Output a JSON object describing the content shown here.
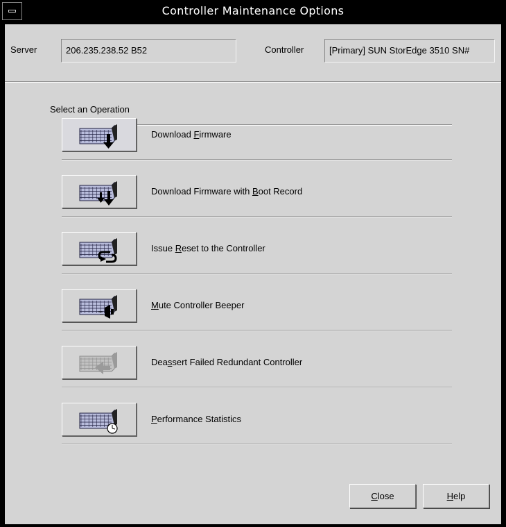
{
  "window": {
    "title": "Controller Maintenance Options"
  },
  "header": {
    "server_label": "Server",
    "server_value": "206.235.238.52 B52",
    "controller_label": "Controller",
    "controller_value": "[Primary] SUN StorEdge 3510 SN#"
  },
  "main": {
    "section_title": "Select an Operation",
    "operations": [
      {
        "pre": "Download ",
        "key": "F",
        "post": "irmware",
        "icon": "download-firmware-icon",
        "enabled": true
      },
      {
        "pre": "Download Firmware with ",
        "key": "B",
        "post": "oot Record",
        "icon": "download-firmware-boot-record-icon",
        "enabled": true
      },
      {
        "pre": "Issue ",
        "key": "R",
        "post": "eset to the Controller",
        "icon": "reset-controller-icon",
        "enabled": true
      },
      {
        "pre": "",
        "key": "M",
        "post": "ute Controller Beeper",
        "icon": "mute-beeper-icon",
        "enabled": true
      },
      {
        "pre": "Dea",
        "key": "s",
        "post": "sert Failed Redundant Controller",
        "icon": "deassert-controller-icon",
        "enabled": false
      },
      {
        "pre": "",
        "key": "P",
        "post": "erformance Statistics",
        "icon": "performance-statistics-icon",
        "enabled": true
      }
    ]
  },
  "footer": {
    "close": {
      "key": "C",
      "rest": "lose"
    },
    "help": {
      "key": "H",
      "rest": "elp"
    }
  },
  "colors": {
    "icon_fill": "#b9bddc",
    "icon_dark": "#000000",
    "disabled": "#9a9a9a"
  }
}
